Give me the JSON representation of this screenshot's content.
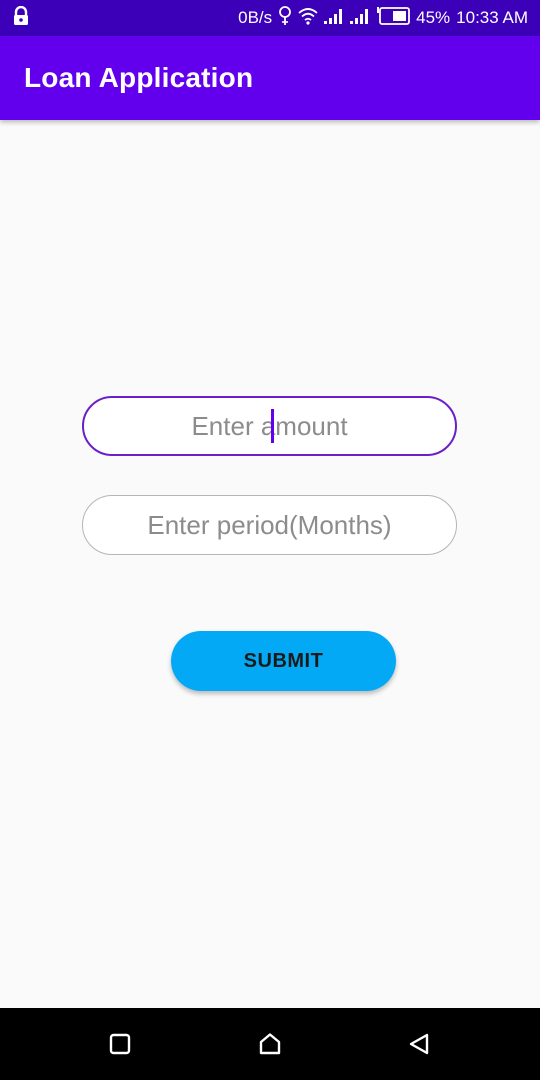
{
  "status_bar": {
    "speed": "0B/s",
    "battery": "45%",
    "time": "10:33 AM",
    "icons": [
      "lock-icon",
      "location-icon",
      "wifi-icon",
      "signal-icon",
      "signal-icon",
      "battery-icon"
    ]
  },
  "app_bar": {
    "title": "Loan Application",
    "color": "#6200ee",
    "status_color": "#3b00b8"
  },
  "form": {
    "amount_placeholder": "Enter amount",
    "period_placeholder": "Enter period(Months)",
    "submit_label": "SUBMIT",
    "submit_color": "#03a9f4"
  },
  "nav_bar": {
    "icons": [
      "recent-apps-icon",
      "home-icon",
      "back-icon"
    ]
  }
}
